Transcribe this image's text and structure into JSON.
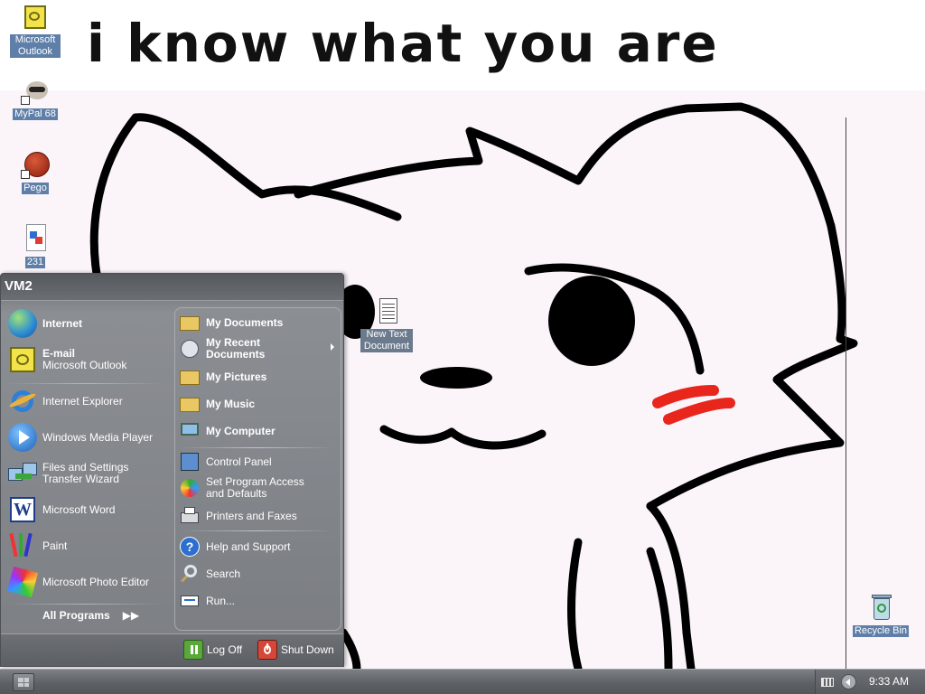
{
  "wallpaper": {
    "banner_text": "i know what you are"
  },
  "desktop_icons": [
    {
      "label": "Microsoft Outlook"
    },
    {
      "label": "MyPal 68"
    },
    {
      "label": "Pego"
    },
    {
      "label": "231"
    },
    {
      "label": "New Text Document"
    },
    {
      "label": "Recycle Bin"
    }
  ],
  "start_menu": {
    "user_name": "VM2",
    "pinned": [
      {
        "title": "Internet"
      },
      {
        "title": "E-mail",
        "subtitle": "Microsoft Outlook"
      }
    ],
    "recent": [
      {
        "label": "Internet Explorer"
      },
      {
        "label": "Windows Media Player"
      },
      {
        "label_line1": "Files and Settings",
        "label_line2": "Transfer Wizard"
      },
      {
        "label": "Microsoft Word"
      },
      {
        "label": "Paint"
      },
      {
        "label": "Microsoft Photo Editor"
      }
    ],
    "all_programs": "All Programs",
    "places": [
      {
        "label": "My Documents"
      },
      {
        "label_line1": "My Recent",
        "label_line2": "Documents"
      },
      {
        "label": "My Pictures"
      },
      {
        "label": "My Music"
      },
      {
        "label": "My Computer"
      }
    ],
    "settings": [
      {
        "label": "Control Panel"
      },
      {
        "label_line1": "Set Program Access",
        "label_line2": "and Defaults"
      },
      {
        "label": "Printers and Faxes"
      }
    ],
    "help": [
      {
        "label": "Help and Support"
      },
      {
        "label": "Search"
      },
      {
        "label": "Run..."
      }
    ],
    "log_off": "Log Off",
    "shut_down": "Shut Down"
  },
  "taskbar": {
    "clock": "9:33 AM"
  },
  "colors": {
    "taskbar": "#5c5f64",
    "menu_bg": "#7c7f84",
    "blush": "#e8261c"
  }
}
